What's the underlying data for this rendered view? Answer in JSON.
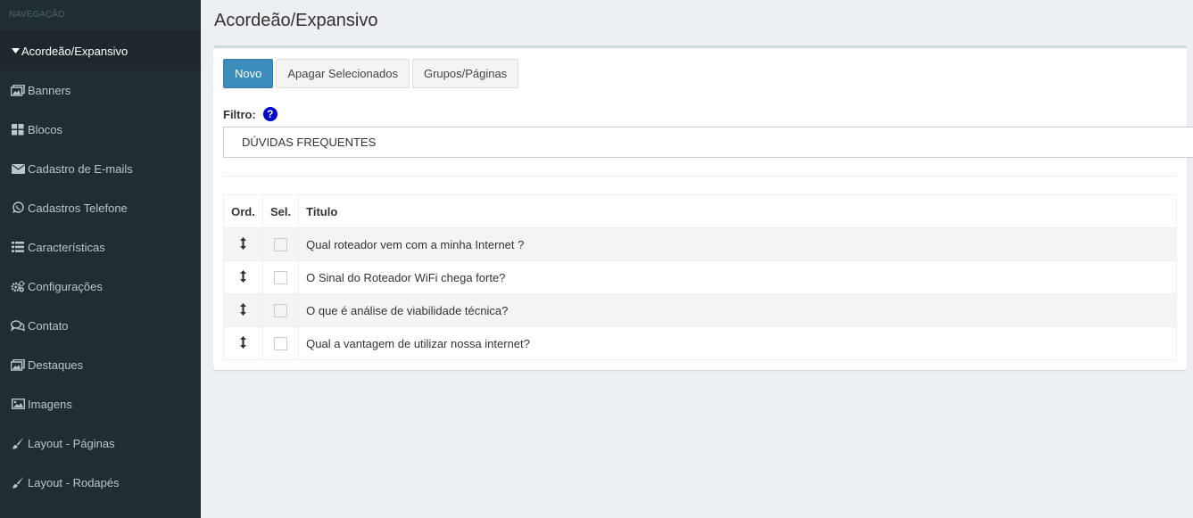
{
  "sidebar": {
    "header": "NAVEGAÇÃO",
    "items": [
      {
        "label": "Acordeão/Expansivo",
        "icon": "caret-down-icon",
        "active": true
      },
      {
        "label": "Banners",
        "icon": "images-icon"
      },
      {
        "label": "Blocos",
        "icon": "th-large-icon"
      },
      {
        "label": "Cadastro de E-mails",
        "icon": "envelope-icon"
      },
      {
        "label": "Cadastros Telefone",
        "icon": "whatsapp-icon"
      },
      {
        "label": "Características",
        "icon": "list-icon"
      },
      {
        "label": "Configurações",
        "icon": "cogs-icon"
      },
      {
        "label": "Contato",
        "icon": "comments-icon"
      },
      {
        "label": "Destaques",
        "icon": "images-icon"
      },
      {
        "label": "Imagens",
        "icon": "image-icon"
      },
      {
        "label": "Layout - Páginas",
        "icon": "paint-brush-icon"
      },
      {
        "label": "Layout - Rodapés",
        "icon": "paint-brush-icon"
      }
    ]
  },
  "page": {
    "title": "Acordeão/Expansivo"
  },
  "toolbar": {
    "new_label": "Novo",
    "delete_selected_label": "Apagar Selecionados",
    "groups_label": "Grupos/Páginas"
  },
  "filter": {
    "label": "Filtro:",
    "help_glyph": "?",
    "selected": "DÚVIDAS FREQUENTES"
  },
  "table": {
    "headers": {
      "ord": "Ord.",
      "sel": "Sel.",
      "title": "Titulo"
    },
    "rows": [
      {
        "title": "Qual roteador vem com a minha Internet ?"
      },
      {
        "title": "O Sinal do Roteador WiFi chega forte?"
      },
      {
        "title": "O que é análise de viabilidade técnica?"
      },
      {
        "title": "Qual a vantagem de utilizar nossa internet?"
      }
    ]
  },
  "colors": {
    "sidebar_bg": "#222d32",
    "primary": "#3c8dbc",
    "help_icon": "#0000cc"
  }
}
